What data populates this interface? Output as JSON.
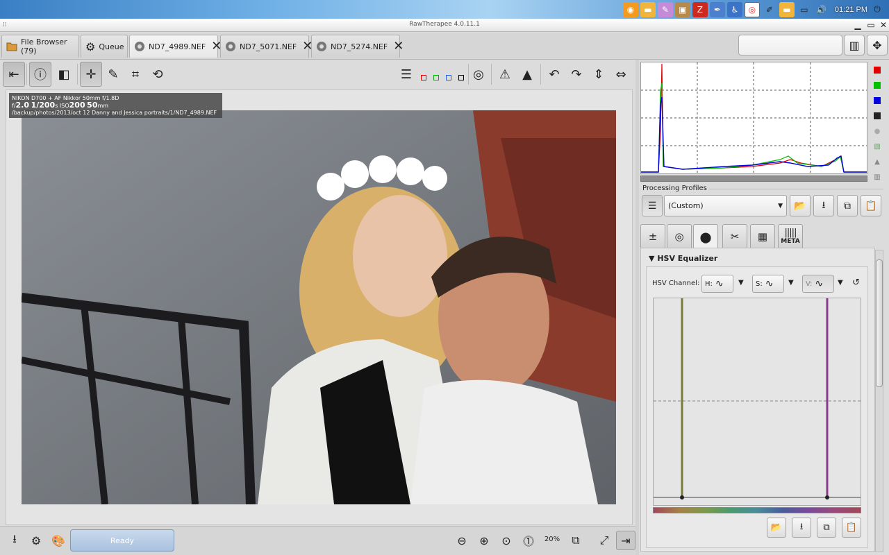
{
  "window": {
    "title": "RawTherapee 4.0.11.1"
  },
  "tray": {
    "clock": "01:21 PM"
  },
  "tabs": [
    {
      "label": "File Browser (79)",
      "closable": false
    },
    {
      "label": "Queue",
      "closable": false
    },
    {
      "label": "ND7_4989.NEF",
      "closable": true,
      "active": true
    },
    {
      "label": "ND7_5071.NEF",
      "closable": true
    },
    {
      "label": "ND7_5274.NEF",
      "closable": true
    }
  ],
  "image_info": {
    "camera": "NIKON D700 + AF Nikkor 50mm f/1.8D",
    "aperture_prefix": "f/",
    "aperture": "2.0",
    "shutter": "1/200",
    "shutter_unit": "s",
    "iso_prefix": "ISO",
    "iso": "200",
    "focal": "50",
    "focal_unit": "mm",
    "path": "/backup/photos/2013/oct 12 Danny and Jessica portraits/1/ND7_4989.NEF"
  },
  "status": {
    "ready": "Ready",
    "zoom": "20%"
  },
  "processing_profiles": {
    "label": "Processing Profiles",
    "selected": "(Custom)"
  },
  "tool_tabs": {
    "meta": "META"
  },
  "hsv": {
    "title": "HSV Equalizer",
    "channel_label": "HSV Channel:",
    "h_label": "H:",
    "s_label": "S:",
    "v_label": "V:"
  },
  "colors": {
    "accent": "#a9c2de",
    "hist_red": "#e00000",
    "hist_green": "#00c000",
    "hist_blue": "#0000e0"
  }
}
